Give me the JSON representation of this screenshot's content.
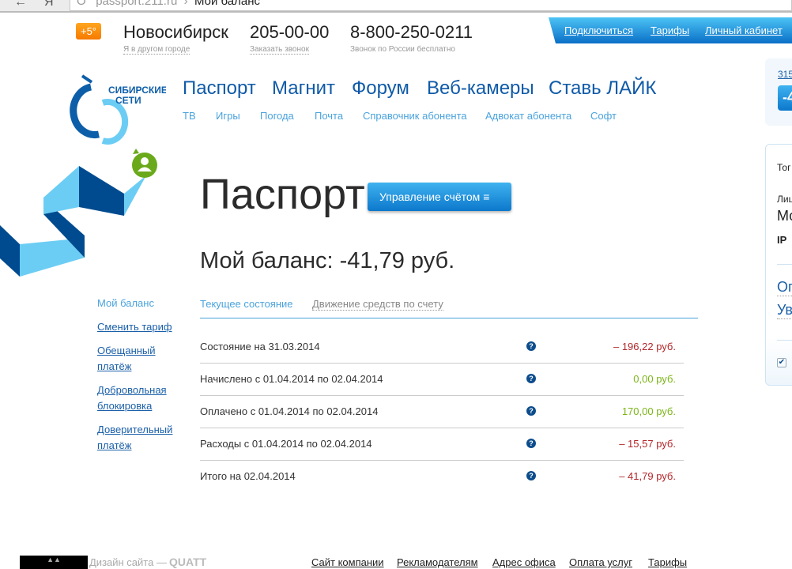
{
  "browser": {
    "url": "passport.211.ru",
    "separator": "›",
    "page_title": "Мой баланс",
    "back": "←",
    "yandex": "Я",
    "reload": "O"
  },
  "header": {
    "temperature": "+5°",
    "city": "Новосибирск",
    "city_link": "Я в другом городе",
    "phone": "205-00-00",
    "phone_link": "Заказать звонок",
    "free_phone": "8-800-250-0211",
    "free_phone_note": "Звонок по России бесплатно"
  },
  "topnav": [
    "Подключиться",
    "Тарифы",
    "Личный кабинет"
  ],
  "logo": {
    "text1": "СИБИРСКИЕ",
    "text2": "СЕТИ"
  },
  "mainnav": [
    "Паспорт",
    "Магнит",
    "Форум",
    "Веб-камеры",
    "Ставь ЛАЙК"
  ],
  "subnav": [
    "ТВ",
    "Игры",
    "Погода",
    "Почта",
    "Справочник абонента",
    "Адвокат абонента",
    "Софт"
  ],
  "page": {
    "title": "Паспорт",
    "manage_button": "Управление счётом",
    "balance": "Мой баланс: -41,79 руб."
  },
  "sidebar": [
    "Мой баланс",
    "Сменить тариф",
    "Обещанный платёж",
    "Добровольная блокировка",
    "Доверительный платёж"
  ],
  "tabs": [
    "Текущее состояние",
    "Движение средств по счету"
  ],
  "rows": [
    {
      "label": "Состояние на 31.03.2014",
      "value": "– 196,22 руб.",
      "color": "#b3262a"
    },
    {
      "label": "Начислено с 01.04.2014 по 02.04.2014",
      "value": "0,00 руб.",
      "color": "#7cb518"
    },
    {
      "label": "Оплачено с 01.04.2014 по 02.04.2014",
      "value": "170,00 руб.",
      "color": "#7cb518"
    },
    {
      "label": "Расходы с 01.04.2014 по 02.04.2014",
      "value": "– 15,57 руб.",
      "color": "#b3262a"
    },
    {
      "label": "Итого на 02.04.2014",
      "value": "– 41,79 руб.",
      "color": "#b3262a"
    }
  ],
  "right_panel": {
    "account": "315",
    "balance": "-4",
    "t1": "Тог",
    "t2": "Лиц",
    "t3": "Мо",
    "t4": "IP",
    "l1": "Ог",
    "l2": "Ув"
  },
  "footer": {
    "design": "Дизайн сайта —",
    "studio": "QUATT",
    "links": [
      "Сайт компании",
      "Рекламодателям",
      "Адрес офиса",
      "Оплата услуг",
      "Тарифы"
    ]
  }
}
